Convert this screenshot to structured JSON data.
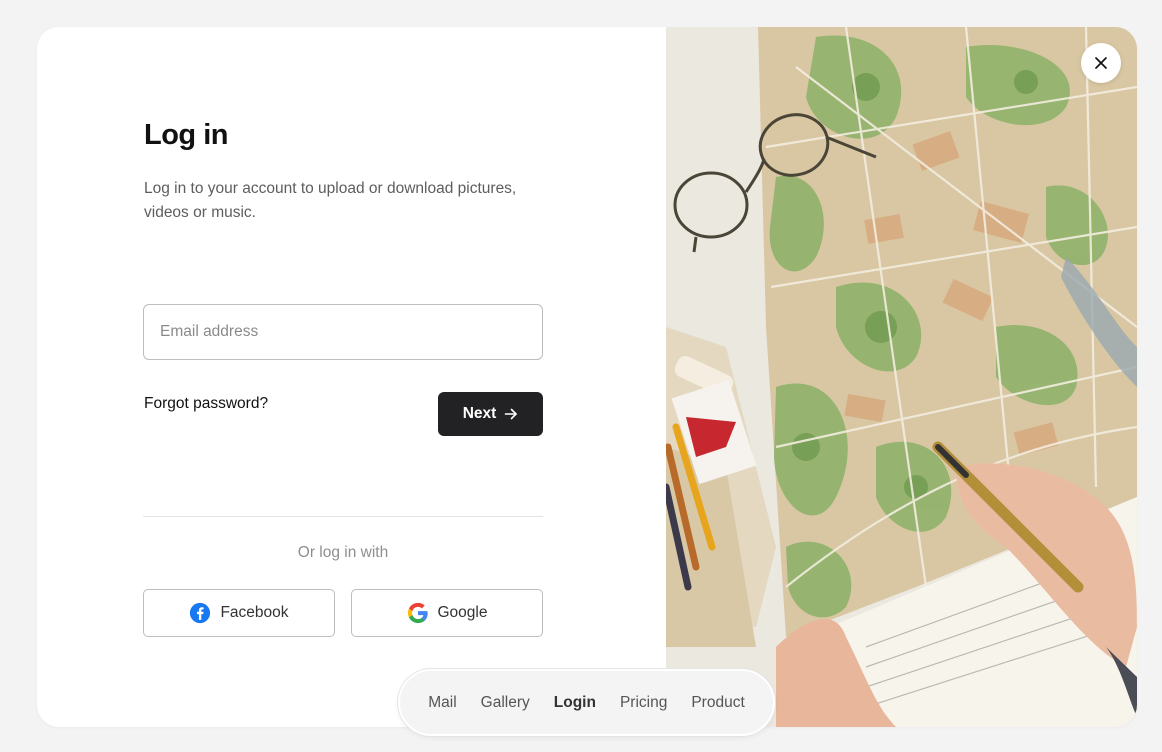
{
  "login": {
    "title": "Log in",
    "subtitle": "Log in to your account to upload or download pictures, videos or music.",
    "email_placeholder": "Email address",
    "email_value": "",
    "forgot_label": "Forgot password?",
    "next_label": "Next",
    "or_text": "Or log in with",
    "social": [
      {
        "label": "Facebook",
        "icon": "facebook-icon",
        "color": "#1877F2"
      },
      {
        "label": "Google",
        "icon": "google-icon"
      }
    ]
  },
  "close_icon": "close-icon",
  "nav": {
    "items": [
      {
        "label": "Mail",
        "active": false
      },
      {
        "label": "Gallery",
        "active": false
      },
      {
        "label": "Login",
        "active": true
      },
      {
        "label": "Pricing",
        "active": false
      },
      {
        "label": "Product",
        "active": false
      }
    ]
  },
  "colors": {
    "primary_button": "#222225",
    "background": "#f3f3f3",
    "card": "#ffffff"
  }
}
